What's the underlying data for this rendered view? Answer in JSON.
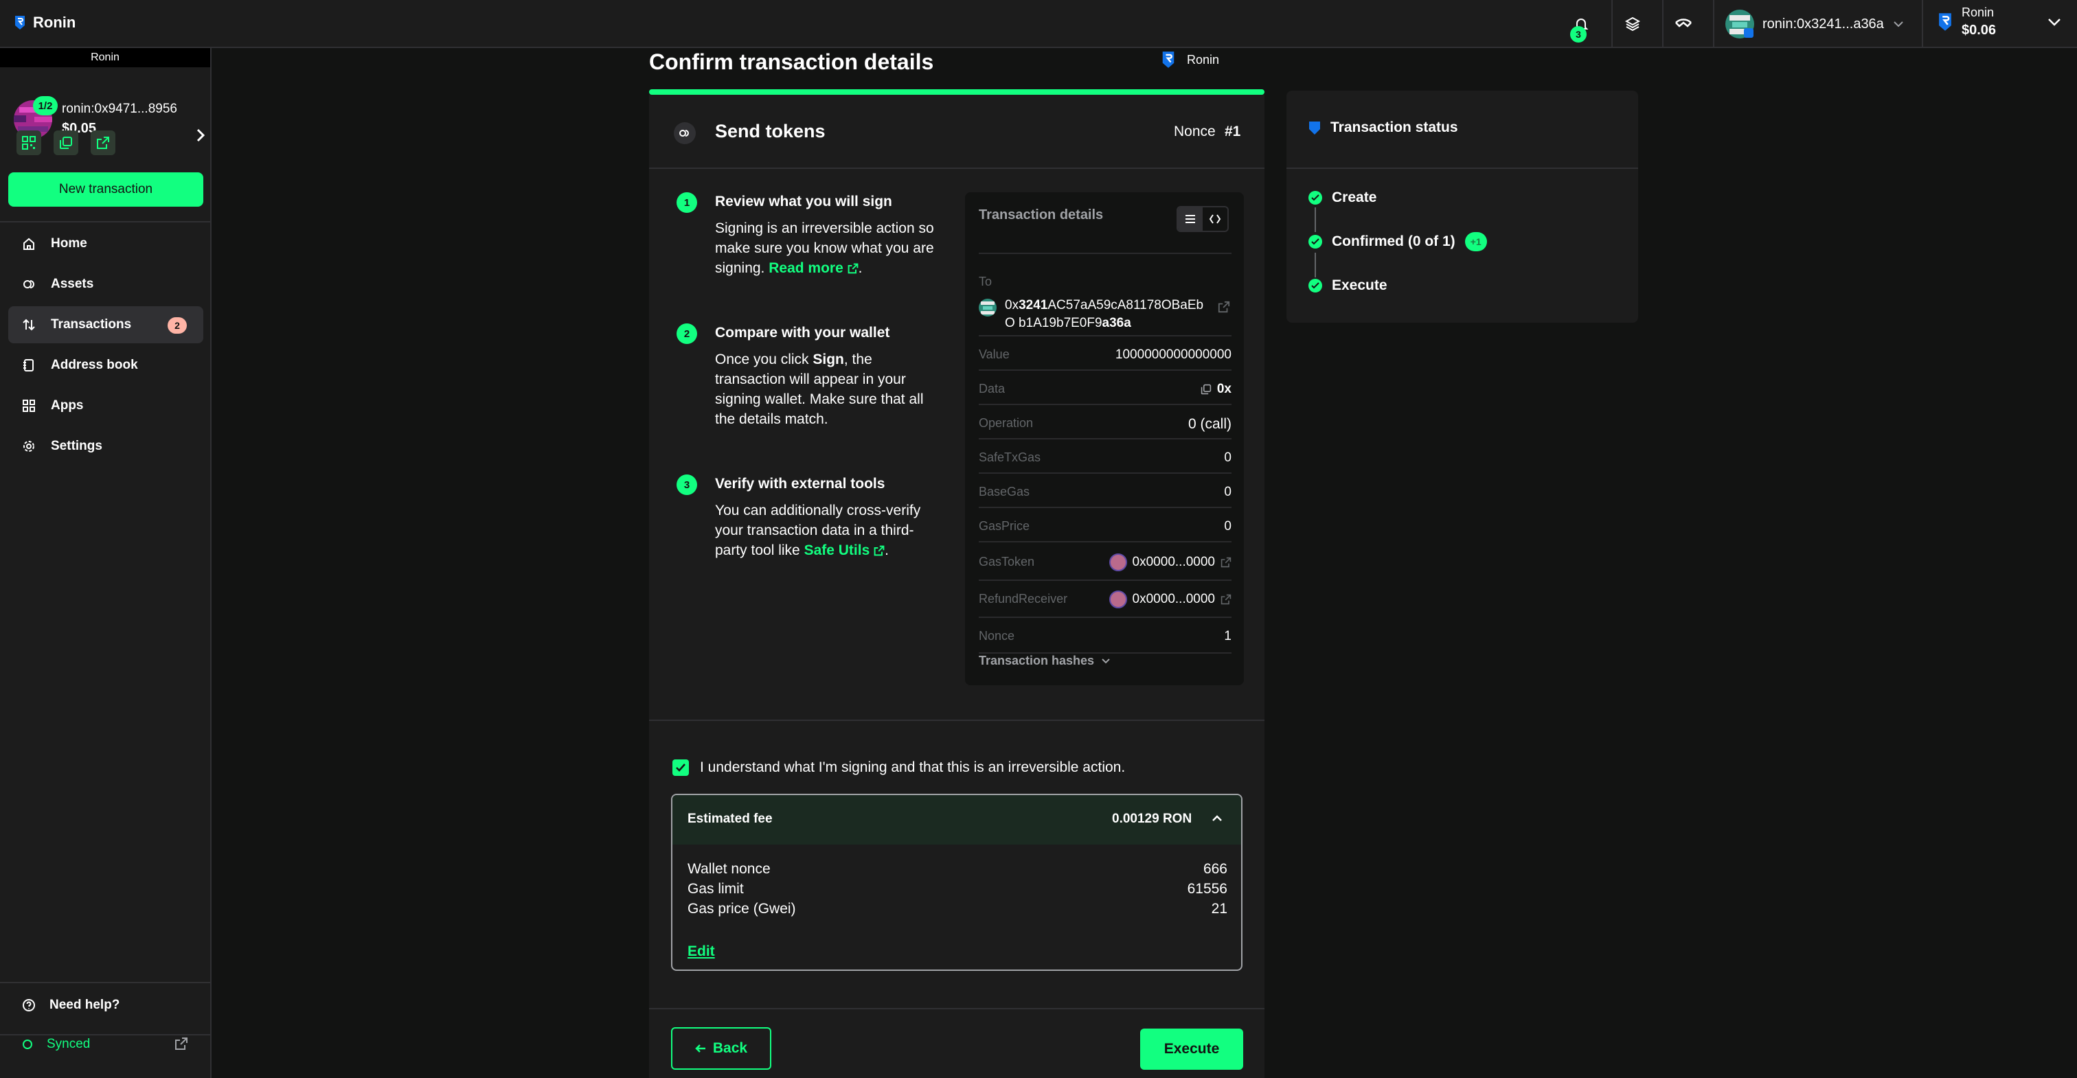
{
  "header": {
    "brand": "Ronin",
    "notification_count": "3",
    "account_address": "ronin:0x3241...a36a",
    "network_name": "Ronin",
    "network_balance": "$0.06"
  },
  "sidebar": {
    "chain_name": "Ronin",
    "threshold": "1/2",
    "safe_address": "ronin:0x9471...8956",
    "safe_balance": "$0.05",
    "new_transaction": "New transaction",
    "nav": [
      {
        "label": "Home",
        "icon": "home-icon"
      },
      {
        "label": "Assets",
        "icon": "assets-icon"
      },
      {
        "label": "Transactions",
        "icon": "transactions-icon",
        "badge": "2"
      },
      {
        "label": "Address book",
        "icon": "address-book-icon"
      },
      {
        "label": "Apps",
        "icon": "apps-icon"
      },
      {
        "label": "Settings",
        "icon": "settings-icon"
      }
    ],
    "help": "Need help?",
    "sync_status": "Synced"
  },
  "main": {
    "page_title": "Confirm transaction details",
    "title_chain": "Ronin",
    "tx_type": "Send tokens",
    "nonce_label": "Nonce",
    "nonce_value": "#1",
    "steps": [
      {
        "num": "1",
        "title": "Review what you will sign",
        "body_pre": "Signing is an irreversible action so make sure you know what you are signing. ",
        "link": "Read more",
        "body_post": "."
      },
      {
        "num": "2",
        "title": "Compare with your wallet",
        "body_pre": "Once you click ",
        "bold": "Sign",
        "body_post": ", the transaction will appear in your signing wallet. Make sure that all the details match."
      },
      {
        "num": "3",
        "title": "Verify with external tools",
        "body_pre": "You can additionally cross-verify your transaction data in a third-party tool like ",
        "link": "Safe Utils",
        "body_post": "."
      }
    ],
    "details": {
      "title": "Transaction details",
      "to_label": "To",
      "to_prefix": "0x",
      "to_bold_start": "3241",
      "to_middle": "AC57aA59cA81178OBaEbO b1A19b7E0F9",
      "to_bold_end": "a36a",
      "rows": [
        {
          "label": "Value",
          "value": "1000000000000000"
        },
        {
          "label": "Data",
          "value": "0x"
        },
        {
          "label": "Operation",
          "value": "0 (call)"
        },
        {
          "label": "SafeTxGas",
          "value": "0"
        },
        {
          "label": "BaseGas",
          "value": "0"
        },
        {
          "label": "GasPrice",
          "value": "0"
        },
        {
          "label": "GasToken",
          "value": "0x0000...0000"
        },
        {
          "label": "RefundReceiver",
          "value": "0x0000...0000"
        },
        {
          "label": "Nonce",
          "value": "1"
        }
      ],
      "hashes_label": "Transaction hashes"
    },
    "confirm_text": "I understand what I'm signing and that this is an irreversible action.",
    "fee": {
      "label": "Estimated fee",
      "value": "0.00129 RON",
      "rows": [
        {
          "label": "Wallet nonce",
          "value": "666"
        },
        {
          "label": "Gas limit",
          "value": "61556"
        },
        {
          "label": "Gas price (Gwei)",
          "value": "21"
        }
      ],
      "edit": "Edit"
    },
    "back": "Back",
    "execute": "Execute"
  },
  "status": {
    "title": "Transaction status",
    "steps": [
      {
        "label": "Create"
      },
      {
        "label": "Confirmed (0 of 1)",
        "badge": "+1"
      },
      {
        "label": "Execute"
      }
    ]
  },
  "colors": {
    "accent": "#12ff80",
    "background": "#121312",
    "panel": "#1c1c1c",
    "border": "#303033",
    "badge_warning": "#ffb4a6",
    "ronin_blue": "#1273ea"
  }
}
